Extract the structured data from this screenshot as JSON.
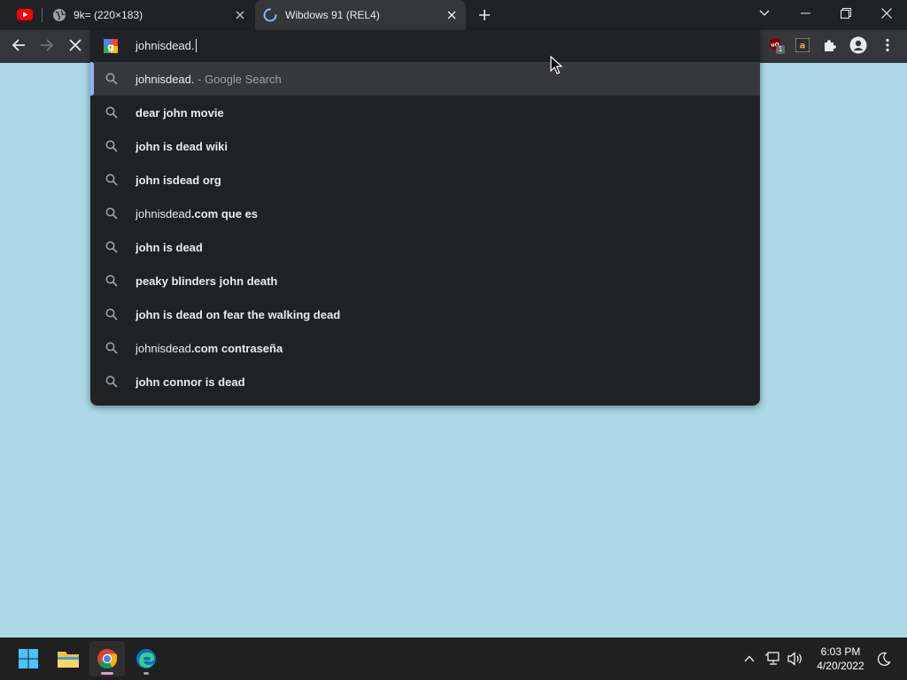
{
  "browser": {
    "tabs": [
      {
        "title": "",
        "icon": "youtube-icon",
        "active": false
      },
      {
        "title": "9k= (220×183)",
        "icon": "globe-icon",
        "active": false
      },
      {
        "title": "Wibdows 91 (REL4)",
        "icon": "loading-spinner-icon",
        "active": true
      }
    ],
    "toolbar": {
      "address_text": "johnisdead.",
      "extension_badge": "1"
    }
  },
  "omnibox": {
    "suggestions": [
      {
        "parts": [
          {
            "t": "johnisdead.",
            "s": "n"
          },
          {
            "t": " - Google Search",
            "s": "dim"
          }
        ],
        "selected": true
      },
      {
        "parts": [
          {
            "t": "dear john movie",
            "s": "b"
          }
        ]
      },
      {
        "parts": [
          {
            "t": "john is dead wiki",
            "s": "b"
          }
        ]
      },
      {
        "parts": [
          {
            "t": "john isdead org",
            "s": "b"
          }
        ]
      },
      {
        "parts": [
          {
            "t": "johnisdead",
            "s": "n"
          },
          {
            "t": ".com que es",
            "s": "b"
          }
        ]
      },
      {
        "parts": [
          {
            "t": "john is dead",
            "s": "b"
          }
        ]
      },
      {
        "parts": [
          {
            "t": "peaky blinders john death",
            "s": "b"
          }
        ]
      },
      {
        "parts": [
          {
            "t": "john is dead on fear the walking dead",
            "s": "b"
          }
        ]
      },
      {
        "parts": [
          {
            "t": "johnisdead",
            "s": "n"
          },
          {
            "t": ".com contraseña",
            "s": "b"
          }
        ]
      },
      {
        "parts": [
          {
            "t": "john connor is dead",
            "s": "b"
          }
        ]
      }
    ]
  },
  "taskbar": {
    "apps": [
      "start-icon",
      "file-explorer-icon",
      "chrome-icon",
      "edge-icon"
    ],
    "clock": {
      "time": "6:03 PM",
      "date": "4/20/2022"
    }
  },
  "colors": {
    "page_background": "#add8e6",
    "toolbar": "#35363a",
    "tabstrip": "#202124",
    "accent": "#8ab4f8"
  }
}
